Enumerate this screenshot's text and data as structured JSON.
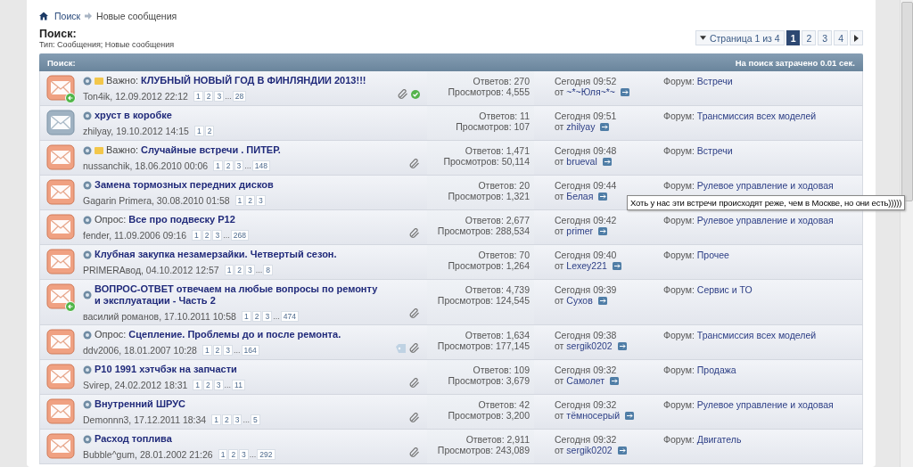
{
  "breadcrumb": [
    {
      "label": "Поиск",
      "kind": "link"
    },
    {
      "label": "Новые сообщения",
      "kind": "current"
    }
  ],
  "heading": "Поиск:",
  "subheading": "Тип: Сообщения; Новые сообщения",
  "pagination": {
    "label": "Страница 1 из 4",
    "pages": [
      {
        "label": "1",
        "selected": true
      },
      {
        "label": "2",
        "selected": false
      },
      {
        "label": "3",
        "selected": false
      },
      {
        "label": "4",
        "selected": false
      }
    ]
  },
  "table": {
    "title": "Поиск:",
    "stats": "На поиск затрачено 0.01 сек.",
    "rows": [
      {
        "unread": true,
        "replied": true,
        "sticky": true,
        "prefix": "Важно:",
        "title": "КЛУБНЫЙ НОВЫЙ ГОД В ФИНЛЯНДИИ 2013!!!",
        "meta": "Ton4ik, 12.09.2012 22:12",
        "pages": [
          {
            "kind": "page",
            "label": "1"
          },
          {
            "kind": "page",
            "label": "2"
          },
          {
            "kind": "page",
            "label": "3"
          },
          {
            "kind": "gap",
            "label": "..."
          },
          {
            "kind": "page",
            "label": "28"
          }
        ],
        "attachment": true,
        "tagged": false,
        "solved": true,
        "replies": "Ответов: 270",
        "views": "Просмотров: 4,555",
        "last_time": "Сегодня 09:52",
        "last_by_label": "от",
        "last_by": "~*~Юля~*~",
        "forum_label": "Форум:",
        "forum": "Встречи"
      },
      {
        "unread": false,
        "replied": false,
        "sticky": false,
        "title": "хруст в коробке",
        "meta": "zhilyay, 19.10.2012 14:15",
        "pages": [
          {
            "kind": "page",
            "label": "1"
          },
          {
            "kind": "page",
            "label": "2"
          }
        ],
        "attachment": false,
        "tagged": false,
        "solved": false,
        "replies": "Ответов: 11",
        "views": "Просмотров: 107",
        "last_time": "Сегодня 09:51",
        "last_by_label": "от",
        "last_by": "zhilyay",
        "forum_label": "Форум:",
        "forum": "Трансмиссия всех моделей"
      },
      {
        "unread": true,
        "replied": false,
        "sticky": true,
        "prefix": "Важно:",
        "title": "Случайные встречи . ПИТЕР.",
        "meta": "nussanchik, 18.06.2010 00:06",
        "pages": [
          {
            "kind": "page",
            "label": "1"
          },
          {
            "kind": "page",
            "label": "2"
          },
          {
            "kind": "page",
            "label": "3"
          },
          {
            "kind": "gap",
            "label": "..."
          },
          {
            "kind": "page",
            "label": "148"
          }
        ],
        "attachment": true,
        "tagged": false,
        "solved": false,
        "replies": "Ответов: 1,471",
        "views": "Просмотров: 50,114",
        "last_time": "Сегодня 09:48",
        "last_by_label": "от",
        "last_by": "brueval",
        "forum_label": "Форум:",
        "forum": "Встречи"
      },
      {
        "unread": true,
        "replied": false,
        "sticky": false,
        "title": "Замена тормозных передних дисков",
        "meta": "Gagarin Primera, 30.08.2010 01:58",
        "pages": [
          {
            "kind": "page",
            "label": "1"
          },
          {
            "kind": "page",
            "label": "2"
          },
          {
            "kind": "page",
            "label": "3"
          }
        ],
        "attachment": false,
        "tagged": false,
        "solved": false,
        "replies": "Ответов: 20",
        "views": "Просмотров: 1,321",
        "last_time": "Сегодня 09:44",
        "last_by_label": "от",
        "last_by": "Белая",
        "forum_label": "Форум:",
        "forum": "Рулевое управление и ходовая"
      },
      {
        "unread": true,
        "replied": false,
        "sticky": false,
        "prefix": "Опрос:",
        "title": "Все про подвеску P12",
        "meta": "fender, 11.09.2006 09:16",
        "pages": [
          {
            "kind": "page",
            "label": "1"
          },
          {
            "kind": "page",
            "label": "2"
          },
          {
            "kind": "page",
            "label": "3"
          },
          {
            "kind": "gap",
            "label": "..."
          },
          {
            "kind": "page",
            "label": "268"
          }
        ],
        "attachment": true,
        "tagged": false,
        "solved": false,
        "replies": "Ответов: 2,677",
        "views": "Просмотров: 288,534",
        "last_time": "Сегодня 09:42",
        "last_by_label": "от",
        "last_by": "primer",
        "forum_label": "Форум:",
        "forum": "Рулевое управление и ходовая"
      },
      {
        "unread": true,
        "replied": false,
        "sticky": false,
        "title": "Клубная закупка незамерзайки. Четвертый сезон.",
        "meta": "PRIMERAвод, 04.10.2012 12:57",
        "pages": [
          {
            "kind": "page",
            "label": "1"
          },
          {
            "kind": "page",
            "label": "2"
          },
          {
            "kind": "page",
            "label": "3"
          },
          {
            "kind": "gap",
            "label": "..."
          },
          {
            "kind": "page",
            "label": "8"
          }
        ],
        "attachment": false,
        "tagged": false,
        "solved": false,
        "replies": "Ответов: 70",
        "views": "Просмотров: 1,264",
        "last_time": "Сегодня 09:40",
        "last_by_label": "от",
        "last_by": "Lexey221",
        "forum_label": "Форум:",
        "forum": "Прочее"
      },
      {
        "unread": true,
        "replied": true,
        "sticky": false,
        "title": "ВОПРОС-ОТВЕТ отвечаем на любые вопросы по ремонту и эксплуатации - Часть 2",
        "meta": "василий романов, 17.10.2011 10:58",
        "pages": [
          {
            "kind": "page",
            "label": "1"
          },
          {
            "kind": "page",
            "label": "2"
          },
          {
            "kind": "page",
            "label": "3"
          },
          {
            "kind": "gap",
            "label": "..."
          },
          {
            "kind": "page",
            "label": "474"
          }
        ],
        "attachment": true,
        "tagged": false,
        "solved": false,
        "replies": "Ответов: 4,739",
        "views": "Просмотров: 124,545",
        "last_time": "Сегодня 09:39",
        "last_by_label": "от",
        "last_by": "Сухов",
        "forum_label": "Форум:",
        "forum": "Сервис и ТО"
      },
      {
        "unread": true,
        "replied": false,
        "sticky": false,
        "prefix": "Опрос:",
        "title": "Сцепление. Проблемы до и после ремонта.",
        "meta": "ddv2006, 18.01.2007 10:28",
        "pages": [
          {
            "kind": "page",
            "label": "1"
          },
          {
            "kind": "page",
            "label": "2"
          },
          {
            "kind": "page",
            "label": "3"
          },
          {
            "kind": "gap",
            "label": "..."
          },
          {
            "kind": "page",
            "label": "164"
          }
        ],
        "attachment": true,
        "tagged": true,
        "solved": false,
        "replies": "Ответов: 1,634",
        "views": "Просмотров: 177,145",
        "last_time": "Сегодня 09:38",
        "last_by_label": "от",
        "last_by": "sergik0202",
        "forum_label": "Форум:",
        "forum": "Трансмиссия всех моделей"
      },
      {
        "unread": true,
        "replied": false,
        "sticky": false,
        "title": "P10 1991 хэтчбэк на запчасти",
        "meta": "Svirep, 24.02.2012 18:31",
        "pages": [
          {
            "kind": "page",
            "label": "1"
          },
          {
            "kind": "page",
            "label": "2"
          },
          {
            "kind": "page",
            "label": "3"
          },
          {
            "kind": "gap",
            "label": "..."
          },
          {
            "kind": "page",
            "label": "11"
          }
        ],
        "attachment": true,
        "tagged": false,
        "solved": false,
        "replies": "Ответов: 109",
        "views": "Просмотров: 3,679",
        "last_time": "Сегодня 09:32",
        "last_by_label": "от",
        "last_by": "Самолет",
        "forum_label": "Форум:",
        "forum": "Продажа"
      },
      {
        "unread": true,
        "replied": false,
        "sticky": false,
        "title": "Внутренний ШРУС",
        "meta": "Demonnn3, 17.12.2011 18:34",
        "pages": [
          {
            "kind": "page",
            "label": "1"
          },
          {
            "kind": "page",
            "label": "2"
          },
          {
            "kind": "page",
            "label": "3"
          },
          {
            "kind": "gap",
            "label": "..."
          },
          {
            "kind": "page",
            "label": "5"
          }
        ],
        "attachment": true,
        "tagged": false,
        "solved": false,
        "replies": "Ответов: 42",
        "views": "Просмотров: 3,200",
        "last_time": "Сегодня 09:32",
        "last_by_label": "от",
        "last_by": "тёмносерый",
        "forum_label": "Форум:",
        "forum": "Рулевое управление и ходовая"
      },
      {
        "unread": true,
        "replied": false,
        "sticky": false,
        "title": "Расход топлива",
        "meta": "Bubble^gum, 28.01.2002 21:26",
        "pages": [
          {
            "kind": "page",
            "label": "1"
          },
          {
            "kind": "page",
            "label": "2"
          },
          {
            "kind": "page",
            "label": "3"
          },
          {
            "kind": "gap",
            "label": "..."
          },
          {
            "kind": "page",
            "label": "292"
          }
        ],
        "attachment": true,
        "tagged": false,
        "solved": false,
        "replies": "Ответов: 2,911",
        "views": "Просмотров: 243,089",
        "last_time": "Сегодня 09:32",
        "last_by_label": "от",
        "last_by": "sergik0202",
        "forum_label": "Форум:",
        "forum": "Двигатель"
      }
    ]
  },
  "tooltip": {
    "text": "Хоть у нас эти встречи происходят реже, чем в Москве, но они есть)))))"
  }
}
